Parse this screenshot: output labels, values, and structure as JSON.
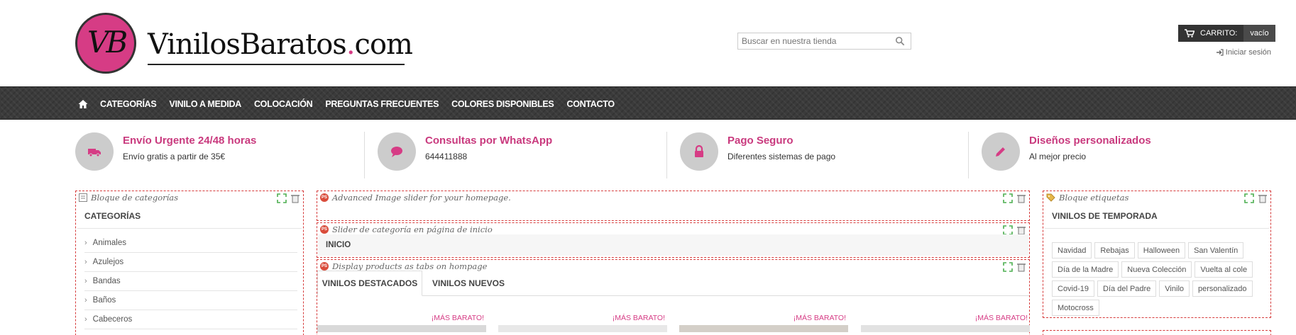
{
  "header": {
    "logo_letters": "VB",
    "logo_text_main": "VinilosBaratos",
    "logo_text_dot": ".",
    "logo_text_tld": "com",
    "search_placeholder": "Buscar en nuestra tienda",
    "search_icon": "search-icon",
    "cart_label": "CARRITO:",
    "cart_status": "vacío",
    "cart_icon": "cart-icon",
    "login_label": "Iniciar sesión",
    "login_icon": "sign-in-icon"
  },
  "nav": {
    "home_icon": "home-icon",
    "items": [
      "CATEGORÍAS",
      "VINILO A MEDIDA",
      "COLOCACIÓN",
      "PREGUNTAS FRECUENTES",
      "COLORES DISPONIBLES",
      "CONTACTO"
    ]
  },
  "features": [
    {
      "title": "Envío Urgente 24/48 horas",
      "subtitle": "Envío gratis a partir de 35€",
      "icon": "truck-icon"
    },
    {
      "title": "Consultas por WhatsApp",
      "subtitle": "644411888",
      "icon": "chat-icon"
    },
    {
      "title": "Pago Seguro",
      "subtitle": "Diferentes sistemas de pago",
      "icon": "lock-icon"
    },
    {
      "title": "Diseños personalizados",
      "subtitle": "Al mejor precio",
      "icon": "pencil-icon"
    }
  ],
  "modules": {
    "categories": {
      "caption": "Bloque de categorías",
      "title": "CATEGORÍAS",
      "items": [
        "Animales",
        "Azulejos",
        "Bandas",
        "Baños",
        "Cabeceros"
      ]
    },
    "slider": {
      "caption": "Advanced Image slider for your homepage."
    },
    "category_slider": {
      "caption": "Slider de categoría en página de inicio",
      "title": "INICIO"
    },
    "product_tabs": {
      "caption": "Display products as tabs on hompage",
      "tabs": [
        "VINILOS DESTACADOS",
        "VINILOS NUEVOS"
      ],
      "badge": "¡MÁS BARATO!"
    },
    "tags": {
      "caption": "Bloque etiquetas",
      "title": "VINILOS DE TEMPORADA",
      "items": [
        "Navidad",
        "Rebajas",
        "Halloween",
        "San Valentín",
        "Día de la Madre",
        "Nueva Colección",
        "Vuelta al cole",
        "Covid-19",
        "Día del Padre",
        "Vinilo",
        "personalizado",
        "Motocross"
      ]
    }
  },
  "colors": {
    "accent": "#c93a7e",
    "nav_bg": "#3b3b3b",
    "module_border": "#d63c3c"
  }
}
